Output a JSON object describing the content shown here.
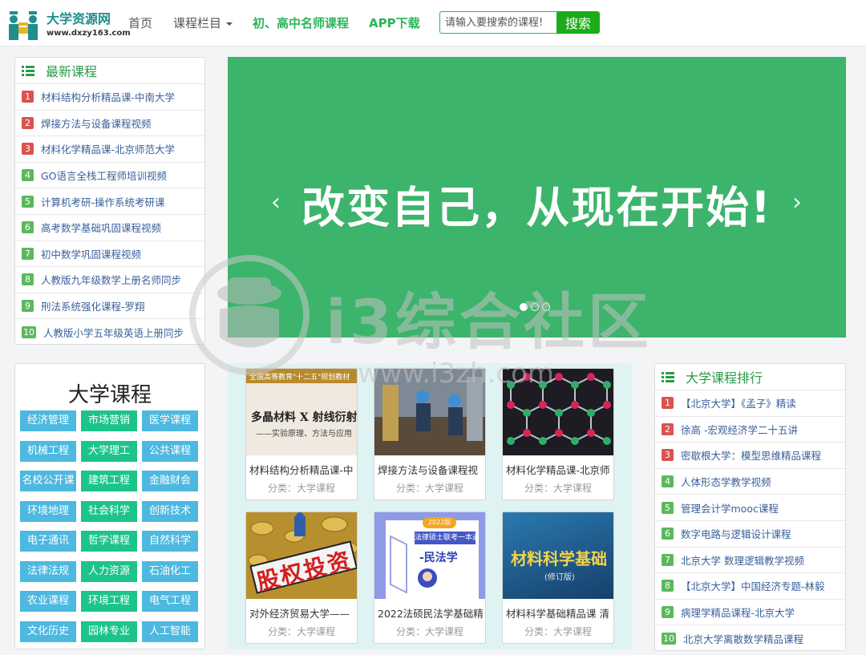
{
  "brand": {
    "name": "大学资源网",
    "url": "www.dxzy163.com"
  },
  "nav": {
    "home": "首页",
    "categories": "课程栏目",
    "teachers": "初、高中名师课程",
    "app": "APP下载"
  },
  "search": {
    "placeholder": "请输入要搜索的课程!",
    "button": "搜索"
  },
  "latest": {
    "title": "最新课程",
    "items": [
      {
        "rank": "1",
        "text": "材料结构分析精品课-中南大学"
      },
      {
        "rank": "2",
        "text": "焊接方法与设备课程视频"
      },
      {
        "rank": "3",
        "text": "材料化学精品课-北京师范大学"
      },
      {
        "rank": "4",
        "text": "GO语言全栈工程师培训视频"
      },
      {
        "rank": "5",
        "text": "计算机考研-操作系统考研课"
      },
      {
        "rank": "6",
        "text": "高考数学基础巩固课程视频"
      },
      {
        "rank": "7",
        "text": "初中数学巩固课程视频"
      },
      {
        "rank": "8",
        "text": "人教版九年级数学上册名师同步"
      },
      {
        "rank": "9",
        "text": "刑法系统强化课程-罗翔"
      },
      {
        "rank": "10",
        "text": "人教版小学五年级英语上册同步"
      }
    ]
  },
  "banner": {
    "slogan": "改变自己，从现在开始!",
    "prev": "‹",
    "next": "›",
    "active_slide": 1,
    "slide_count": 3
  },
  "university": {
    "title": "大学课程",
    "tags": [
      "经济管理",
      "市场营销",
      "医学课程",
      "机械工程",
      "大学理工",
      "公共课程",
      "名校公开课",
      "建筑工程",
      "金融财会",
      "环境地理",
      "社会科学",
      "创新技术",
      "电子通讯",
      "哲学课程",
      "自然科学",
      "法律法规",
      "人力资源",
      "石油化工",
      "农业课程",
      "环境工程",
      "电气工程",
      "文化历史",
      "园林专业",
      "人工智能"
    ]
  },
  "cards": [
    {
      "title": "材料结构分析精品课-中",
      "category": "分类：大学课程",
      "cover_title": "多晶材料 X 射线衍射",
      "cover_sub": "——实验原理、方法与应用",
      "cover_top": "全国高等教育\"十二五\"规划教材"
    },
    {
      "title": "焊接方法与设备课程视",
      "category": "分类：大学课程"
    },
    {
      "title": "材料化学精品课-北京师",
      "category": "分类：大学课程"
    },
    {
      "title": "对外经济贸易大学——",
      "category": "分类：大学课程",
      "cover_title": "股权投资"
    },
    {
      "title": "2022法硕民法学基础精",
      "category": "分类：大学课程",
      "cover_title": "法律硕士联考一本通",
      "cover_sub": "-民法学",
      "cover_badge": "2022版"
    },
    {
      "title": "材料科学基础精品课 清",
      "category": "分类：大学课程",
      "cover_title": "材料科学基础",
      "cover_sub": "(修订版)"
    }
  ],
  "ranking": {
    "title": "大学课程排行",
    "items": [
      {
        "rank": "1",
        "text": "【北京大学】《孟子》精读"
      },
      {
        "rank": "2",
        "text": "徐高 -宏观经济学二十五讲"
      },
      {
        "rank": "3",
        "text": "密歇根大学：模型思维精品课程"
      },
      {
        "rank": "4",
        "text": "人体形态学教学视频"
      },
      {
        "rank": "5",
        "text": "管理会计学mooc课程"
      },
      {
        "rank": "6",
        "text": "数字电路与逻辑设计课程"
      },
      {
        "rank": "7",
        "text": "北京大学 数理逻辑教学视频"
      },
      {
        "rank": "8",
        "text": "【北京大学】中国经济专题-林毅"
      },
      {
        "rank": "9",
        "text": "病理学精品课程-北京大学"
      },
      {
        "rank": "10",
        "text": "北京大学离散数学精品课程"
      }
    ]
  },
  "watermark": {
    "text": "i3综合社区",
    "url": "www.i3zh.com"
  },
  "colors": {
    "accent": "#2bb55a",
    "banner": "#3cb46b",
    "tag_blue": "#4db8e0",
    "tag_green": "#1cc48a",
    "rank_red": "#d9534f",
    "rank_green": "#5cb85c"
  }
}
